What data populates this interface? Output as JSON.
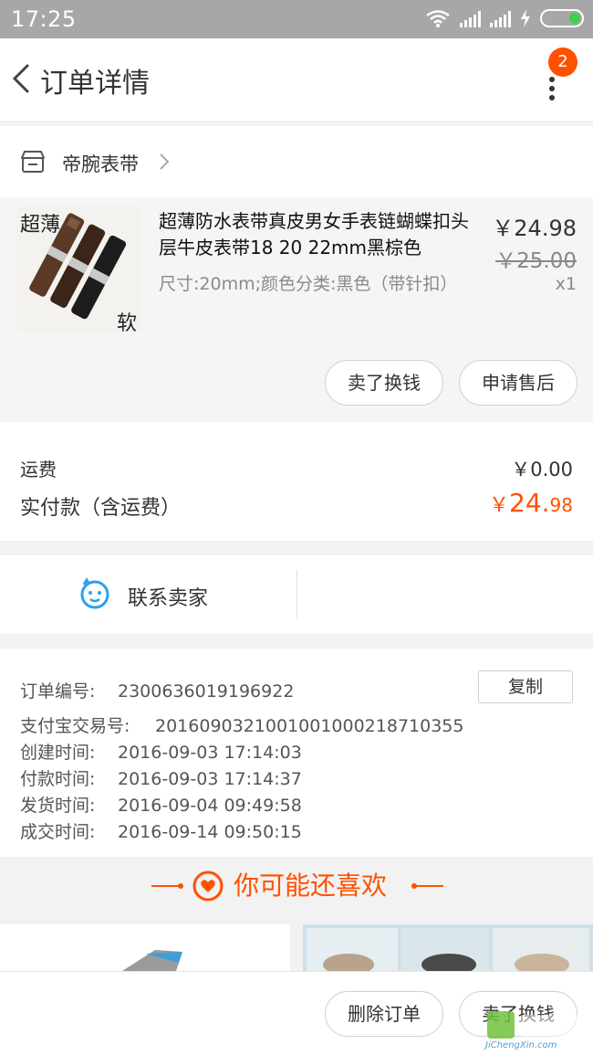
{
  "status_bar": {
    "time": "17:25"
  },
  "header": {
    "title": "订单详情",
    "badge_count": "2"
  },
  "shop": {
    "name": "帝腕表带"
  },
  "product": {
    "title": "超薄防水表带真皮男女手表链蝴蝶扣头层牛皮表带18 20 22mm黑棕色",
    "spec": "尺寸:20mm;颜色分类:黑色（带针扣）",
    "price": "￥24.98",
    "original_price": "￥25.00",
    "quantity": "x1",
    "thumb_text_top": "超薄",
    "thumb_text_bottom": "软",
    "buttons": {
      "sell": "卖了换钱",
      "after_sale": "申请售后"
    }
  },
  "fees": {
    "shipping_label": "运费",
    "shipping_value": "￥0.00",
    "paid_label": "实付款（含运费）",
    "paid_currency": "￥",
    "paid_int": "24.",
    "paid_dec": "98"
  },
  "contact": {
    "label": "联系卖家"
  },
  "order_info": {
    "copy_label": "复制",
    "rows": [
      {
        "k": "订单编号:",
        "v": "2300636019196922"
      },
      {
        "k": "支付宝交易号:",
        "v": "2016090321001001000218710355"
      },
      {
        "k": "创建时间:",
        "v": "2016-09-03 17:14:03"
      },
      {
        "k": "付款时间:",
        "v": "2016-09-03 17:14:37"
      },
      {
        "k": "发货时间:",
        "v": "2016-09-04 09:49:58"
      },
      {
        "k": "成交时间:",
        "v": "2016-09-14 09:50:15"
      }
    ]
  },
  "recommend": {
    "title": "你可能还喜欢"
  },
  "bottom": {
    "delete": "删除订单",
    "sell": "卖了换钱"
  },
  "watermark": {
    "text": "JiChengXin.com"
  },
  "colors": {
    "accent": "#ff5000",
    "blue": "#2ba0f0",
    "statusbar": "#a7a7a7"
  }
}
